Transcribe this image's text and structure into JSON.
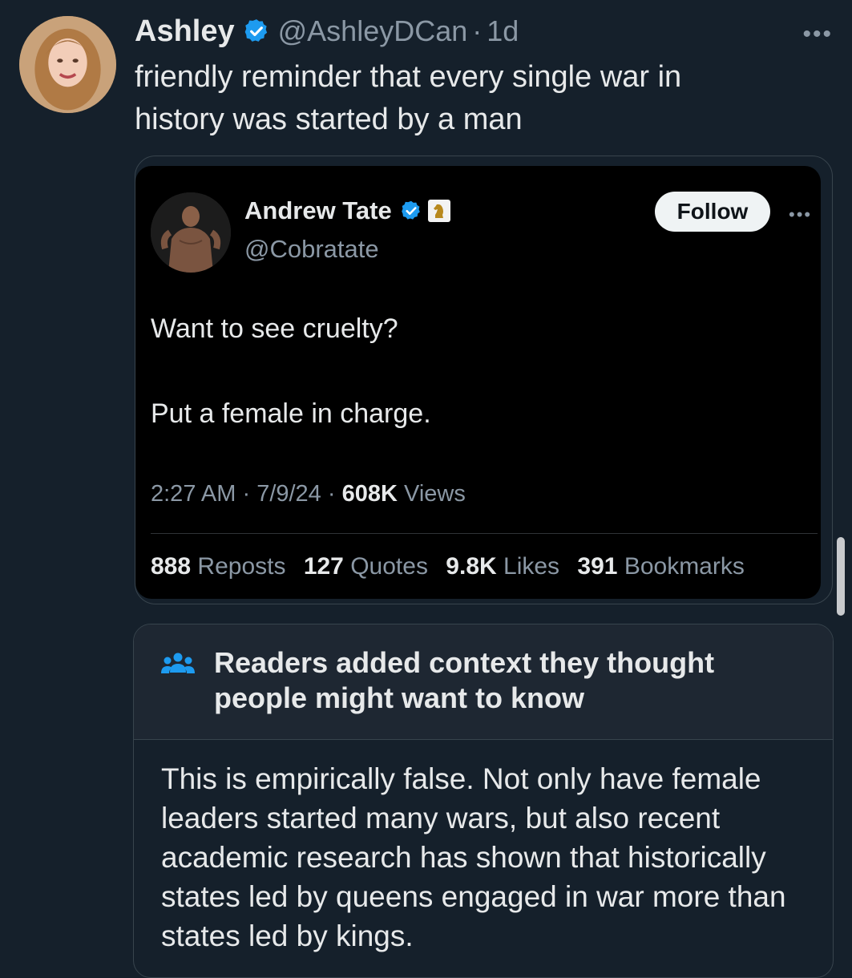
{
  "tweet": {
    "author_name": "Ashley",
    "handle": "@AshleyDCan",
    "time": "1d",
    "text": "friendly reminder that every single war in\nhistory was started by a man",
    "more_icon": "ellipsis-icon"
  },
  "quoted_tweet": {
    "author_name": "Andrew Tate",
    "handle": "@Cobratate",
    "follow_label": "Follow",
    "line1": "Want to see cruelty?",
    "line2": "Put a female in charge.",
    "time": "2:27 AM",
    "date": "7/9/24",
    "views_count": "608K",
    "views_label": "Views",
    "stats": [
      {
        "count": "888",
        "label": "Reposts"
      },
      {
        "count": "127",
        "label": "Quotes"
      },
      {
        "count": "9.8K",
        "label": "Likes"
      },
      {
        "count": "391",
        "label": "Bookmarks"
      }
    ]
  },
  "community_note": {
    "title": "Readers added context they thought people might want to know",
    "body": "This is empirically false. Not only have female leaders started many wars, but also recent academic research has shown that historically states led by queens engaged in war more than states led by kings."
  },
  "colors": {
    "background": "#15202b",
    "verified_blue": "#1d9bf0",
    "secondary_text": "#8b98a5"
  }
}
